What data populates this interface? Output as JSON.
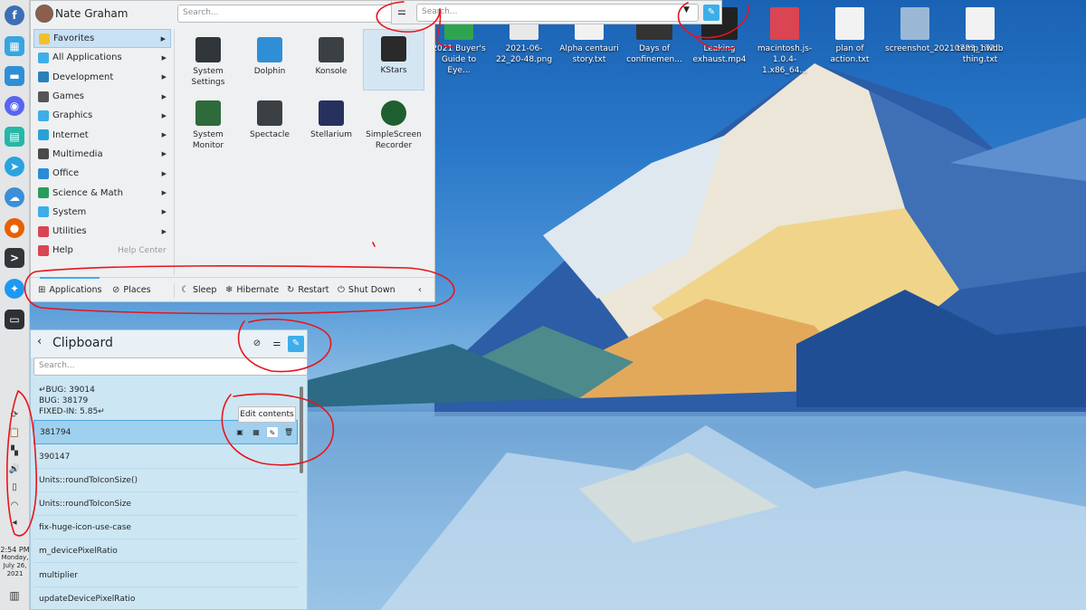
{
  "launcher": {
    "user_name": "Nate Graham",
    "search_placeholder": "Search...",
    "categories": [
      {
        "label": "Favorites",
        "icon": "star-icon",
        "color": "#f3c02b"
      },
      {
        "label": "All Applications",
        "icon": "grid-icon",
        "color": "#3daee9"
      },
      {
        "label": "Development",
        "icon": "development-icon",
        "color": "#2980b9"
      },
      {
        "label": "Games",
        "icon": "gamepad-icon",
        "color": "#555555"
      },
      {
        "label": "Graphics",
        "icon": "graphics-icon",
        "color": "#3daee9"
      },
      {
        "label": "Internet",
        "icon": "globe-icon",
        "color": "#2aa1d8"
      },
      {
        "label": "Multimedia",
        "icon": "multimedia-icon",
        "color": "#4a4a4a"
      },
      {
        "label": "Office",
        "icon": "office-icon",
        "color": "#2a8bd6"
      },
      {
        "label": "Science & Math",
        "icon": "science-icon",
        "color": "#2b9c5b"
      },
      {
        "label": "System",
        "icon": "system-icon",
        "color": "#3daee9"
      },
      {
        "label": "Utilities",
        "icon": "utilities-icon",
        "color": "#da4453"
      },
      {
        "label": "Help",
        "icon": "help-icon",
        "color": "#da4453",
        "extra": "Help Center"
      }
    ],
    "apps": [
      {
        "label": "System Settings",
        "icon": "settings-icon"
      },
      {
        "label": "Dolphin",
        "icon": "folder-icon"
      },
      {
        "label": "Konsole",
        "icon": "terminal-icon"
      },
      {
        "label": "KStars",
        "icon": "telescope-icon"
      },
      {
        "label": "System Monitor",
        "icon": "monitor-icon"
      },
      {
        "label": "Spectacle",
        "icon": "camera-icon"
      },
      {
        "label": "Stellarium",
        "icon": "stellarium-icon"
      },
      {
        "label": "SimpleScreen Recorder",
        "icon": "recorder-icon"
      }
    ],
    "footer": {
      "applications": "Applications",
      "places": "Places",
      "sleep": "Sleep",
      "hibernate": "Hibernate",
      "restart": "Restart",
      "shutdown": "Shut Down"
    }
  },
  "krunner": {
    "search_placeholder": "Search..."
  },
  "clipboard": {
    "title": "Clipboard",
    "search_placeholder": "Search...",
    "items": [
      "↵BUG: 39014\nBUG: 38179\nFIXED-IN: 5.85↵",
      "381794",
      "390147",
      "Units::roundToIconSize()",
      "Units::roundToIconSize",
      "fix-huge-icon-use-case",
      "m_devicePixelRatio",
      "multiplier",
      "updateDevicePixelRatio"
    ],
    "tooltip": "Edit contents"
  },
  "clock": {
    "time": "2:54 PM",
    "day": "Monday,",
    "date": "July 26,",
    "year": "2021"
  },
  "desktop_icons": [
    {
      "label": "2021 Buyer's Guide to Eye...",
      "color": "#2ea44f"
    },
    {
      "label": "2021-06-22_20-48.png",
      "color": "#e8e8e8"
    },
    {
      "label": "Alpha centauri story.txt",
      "color": "#f2f2f2"
    },
    {
      "label": "Days of confinemen...",
      "color": "#333333"
    },
    {
      "label": "Leaking exhaust.mp4",
      "color": "#222222"
    },
    {
      "label": "macintosh.js-1.0.4-1.x86_64...",
      "color": "#da4453"
    },
    {
      "label": "plan of action.txt",
      "color": "#f2f2f2"
    },
    {
      "label": "screenshot_20210723_172...",
      "color": "#9ab8d6"
    },
    {
      "label": "temp hwdb thing.txt",
      "color": "#f2f2f2"
    }
  ],
  "colors": {
    "accent": "#3daee9",
    "annotation": "#e8141c"
  }
}
